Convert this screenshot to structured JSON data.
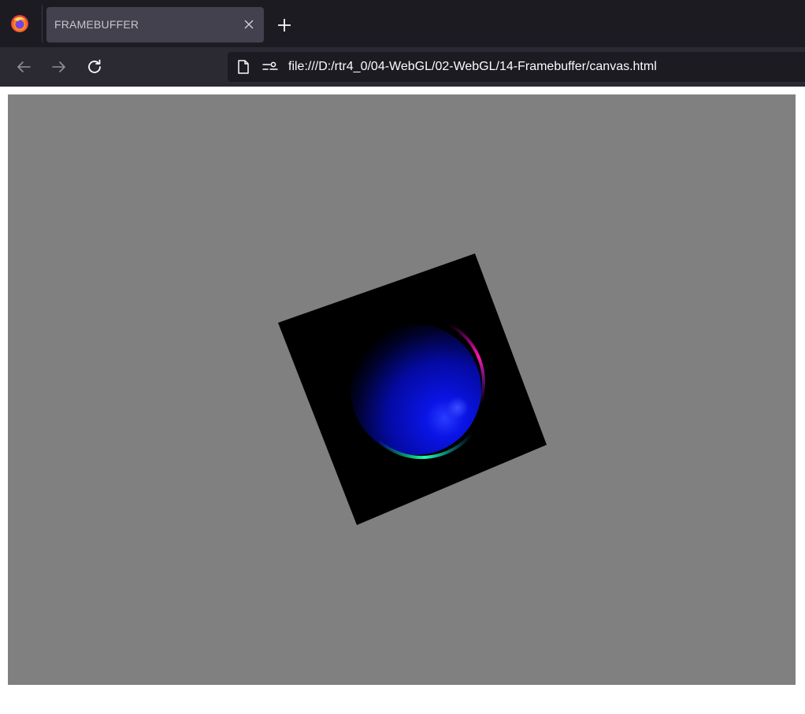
{
  "browser": {
    "tab": {
      "title": "FRAMEBUFFER"
    },
    "address_bar": {
      "url": "file:///D:/rtr4_0/04-WebGL/02-WebGL/14-Framebuffer/canvas.html"
    },
    "icons": {
      "logo": "firefox-icon",
      "close": "close-icon",
      "new_tab": "plus-icon",
      "back": "back-arrow-icon",
      "forward": "forward-arrow-icon",
      "reload": "reload-icon",
      "page": "page-icon",
      "permissions": "permissions-icon"
    }
  },
  "canvas": {
    "clear_color": "#808080",
    "quad_color": "#000000",
    "sphere_colors": [
      "#0000ff",
      "#ff00ff",
      "#00ff80"
    ]
  }
}
